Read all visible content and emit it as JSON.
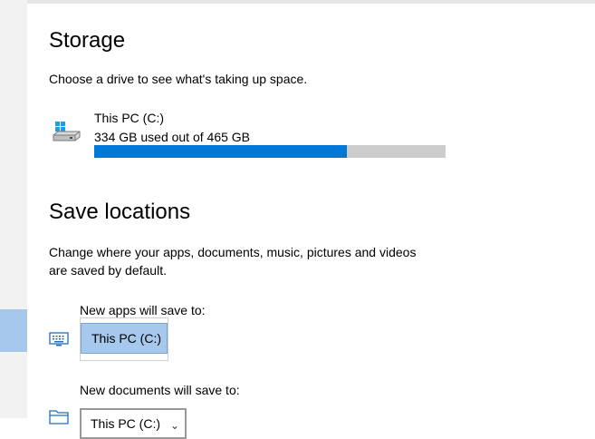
{
  "storage": {
    "heading": "Storage",
    "description": "Choose a drive to see what's taking up space.",
    "drive": {
      "name": "This PC (C:)",
      "usage_text": "334 GB used out of 465 GB",
      "used_fraction": 0.718
    }
  },
  "save_locations": {
    "heading": "Save locations",
    "description_line1": "Change where your apps, documents, music, pictures and videos",
    "description_line2": "are saved by default.",
    "apps": {
      "label": "New apps will save to:",
      "selected_option": "This PC (C:)"
    },
    "documents": {
      "label": "New documents will save to:",
      "selected_value": "This PC (C:)"
    }
  },
  "colors": {
    "accent": "#0078d7",
    "selection": "#a5c8ec",
    "bar_track": "#cccccc"
  },
  "icons": {
    "drive": "windows-drive-icon",
    "apps": "monitor-keyboard-icon",
    "documents": "folder-icon",
    "dropdown": "chevron-down-icon"
  }
}
